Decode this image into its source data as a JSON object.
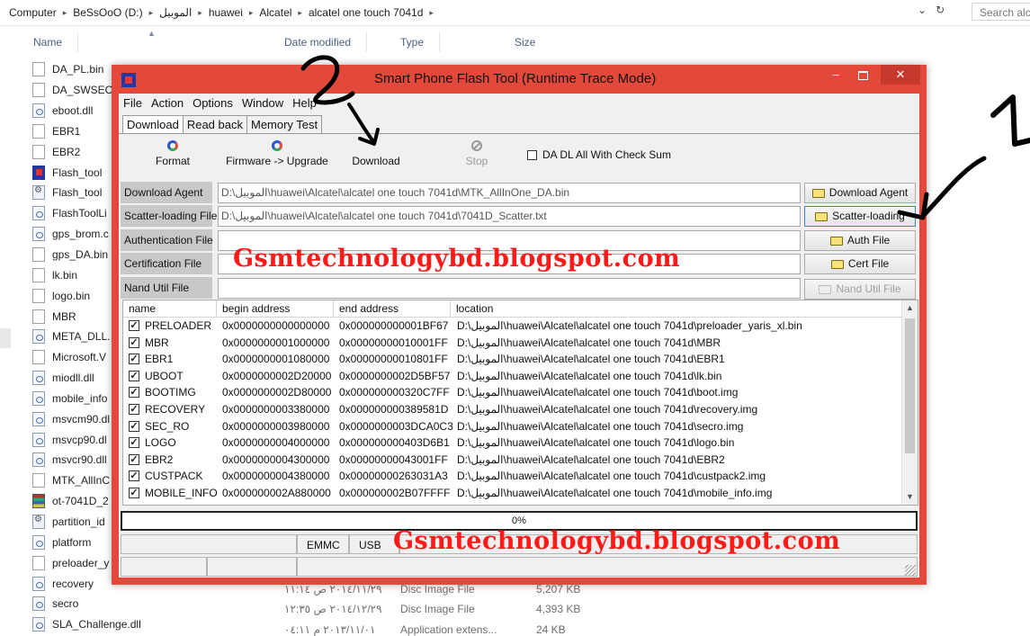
{
  "explorer": {
    "breadcrumbs": [
      "Computer",
      "BeSsOoO (D:)",
      "الموبيل",
      "huawei",
      "Alcatel",
      "alcatel one touch  7041d"
    ],
    "search_placeholder": "Search alc",
    "columns": {
      "name": "Name",
      "date": "Date modified",
      "type": "Type",
      "size": "Size"
    },
    "files": [
      {
        "name": "DA_PL.bin",
        "icon": "file-icon"
      },
      {
        "name": "DA_SWSEC.",
        "icon": "file-icon"
      },
      {
        "name": "eboot.dll",
        "icon": "dll-icon"
      },
      {
        "name": "EBR1",
        "icon": "file-icon"
      },
      {
        "name": "EBR2",
        "icon": "file-icon"
      },
      {
        "name": "Flash_tool",
        "icon": "exe-icon"
      },
      {
        "name": "Flash_tool",
        "icon": "config-icon"
      },
      {
        "name": "FlashToolLi",
        "icon": "dll-icon"
      },
      {
        "name": "gps_brom.c",
        "icon": "dll-icon"
      },
      {
        "name": "gps_DA.bin",
        "icon": "file-icon"
      },
      {
        "name": "lk.bin",
        "icon": "file-icon"
      },
      {
        "name": "logo.bin",
        "icon": "file-icon"
      },
      {
        "name": "MBR",
        "icon": "file-icon"
      },
      {
        "name": "META_DLL.",
        "icon": "dll-icon"
      },
      {
        "name": "Microsoft.V",
        "icon": "file-icon"
      },
      {
        "name": "miodll.dll",
        "icon": "dll-icon"
      },
      {
        "name": "mobile_info",
        "icon": "dll-icon"
      },
      {
        "name": "msvcm90.dl",
        "icon": "dll-icon"
      },
      {
        "name": "msvcp90.dl",
        "icon": "dll-icon"
      },
      {
        "name": "msvcr90.dll",
        "icon": "dll-icon"
      },
      {
        "name": "MTK_AllInC",
        "icon": "file-icon"
      },
      {
        "name": "ot-7041D_2",
        "icon": "rar-icon"
      },
      {
        "name": "partition_id",
        "icon": "config-icon"
      },
      {
        "name": "platform",
        "icon": "dll-icon"
      },
      {
        "name": "preloader_y",
        "icon": "file-icon"
      },
      {
        "name": "recovery",
        "icon": "dll-icon"
      },
      {
        "name": "secro",
        "icon": "dll-icon"
      },
      {
        "name": "SLA_Challenge.dll",
        "icon": "dll-icon"
      }
    ],
    "bottom_rows": [
      {
        "date": "٢٠١٤/١١/٢٩ ص ١١:١٤",
        "type": "Disc Image File",
        "size": "5,207 KB"
      },
      {
        "date": "٢٠١٤/١٢/٢٩ ص ١٢:٣٥",
        "type": "Disc Image File",
        "size": "4,393 KB"
      },
      {
        "date": "٢٠١٣/١١/٠١ م ٠٤:١١",
        "type": "Application extens...",
        "size": "24 KB"
      }
    ]
  },
  "flashtool": {
    "title": "Smart Phone Flash Tool (Runtime Trace Mode)",
    "menu": [
      "File",
      "Action",
      "Options",
      "Window",
      "Help"
    ],
    "tabs": [
      "Download",
      "Read back",
      "Memory Test"
    ],
    "toolbar": {
      "format": "Format",
      "firmware": "Firmware -> Upgrade",
      "download": "Download",
      "stop": "Stop"
    },
    "da_checksum_label": "DA DL All With Check Sum",
    "fields": [
      {
        "label": "Download Agent",
        "value": "D:\\الموبيل\\huawei\\Alcatel\\alcatel one touch  7041d\\MTK_AllInOne_DA.bin",
        "button": "Download Agent"
      },
      {
        "label": "Scatter-loading File",
        "value": "D:\\الموبيل\\huawei\\Alcatel\\alcatel one touch  7041d\\7041D_Scatter.txt",
        "button": "Scatter-loading"
      },
      {
        "label": "Authentication File",
        "value": "",
        "button": "Auth File"
      },
      {
        "label": "Certification File",
        "value": "",
        "button": "Cert File"
      },
      {
        "label": "Nand Util File",
        "value": "",
        "button": "Nand Util File"
      }
    ],
    "table": {
      "headers": [
        "name",
        "begin address",
        "end address",
        "location"
      ],
      "rows": [
        {
          "name": "PRELOADER",
          "begin": "0x0000000000000000",
          "end": "0x000000000001BF67",
          "location": "D:\\الموبيل\\huawei\\Alcatel\\alcatel one touch  7041d\\preloader_yaris_xl.bin"
        },
        {
          "name": "MBR",
          "begin": "0x0000000001000000",
          "end": "0x00000000010001FF",
          "location": "D:\\الموبيل\\huawei\\Alcatel\\alcatel one touch  7041d\\MBR"
        },
        {
          "name": "EBR1",
          "begin": "0x0000000001080000",
          "end": "0x00000000010801FF",
          "location": "D:\\الموبيل\\huawei\\Alcatel\\alcatel one touch  7041d\\EBR1"
        },
        {
          "name": "UBOOT",
          "begin": "0x0000000002D20000",
          "end": "0x0000000002D5BF57",
          "location": "D:\\الموبيل\\huawei\\Alcatel\\alcatel one touch  7041d\\lk.bin"
        },
        {
          "name": "BOOTIMG",
          "begin": "0x0000000002D80000",
          "end": "0x000000000320C7FF",
          "location": "D:\\الموبيل\\huawei\\Alcatel\\alcatel one touch  7041d\\boot.img"
        },
        {
          "name": "RECOVERY",
          "begin": "0x0000000003380000",
          "end": "0x000000000389581D",
          "location": "D:\\الموبيل\\huawei\\Alcatel\\alcatel one touch  7041d\\recovery.img"
        },
        {
          "name": "SEC_RO",
          "begin": "0x0000000003980000",
          "end": "0x0000000003DCA0C3",
          "location": "D:\\الموبيل\\huawei\\Alcatel\\alcatel one touch  7041d\\secro.img"
        },
        {
          "name": "LOGO",
          "begin": "0x0000000004000000",
          "end": "0x000000000403D6B1",
          "location": "D:\\الموبيل\\huawei\\Alcatel\\alcatel one touch  7041d\\logo.bin"
        },
        {
          "name": "EBR2",
          "begin": "0x0000000004300000",
          "end": "0x00000000043001FF",
          "location": "D:\\الموبيل\\huawei\\Alcatel\\alcatel one touch  7041d\\EBR2"
        },
        {
          "name": "CUSTPACK",
          "begin": "0x0000000004380000",
          "end": "0x00000000263031A3",
          "location": "D:\\الموبيل\\huawei\\Alcatel\\alcatel one touch  7041d\\custpack2.img"
        },
        {
          "name": "MOBILE_INFO",
          "begin": "0x000000002A880000",
          "end": "0x000000002B07FFFF",
          "location": "D:\\الموبيل\\huawei\\Alcatel\\alcatel one touch  7041d\\mobile_info.img"
        }
      ]
    },
    "progress_text": "0%",
    "progress_value": 0,
    "status": {
      "emmc": "EMMC",
      "usb": "USB"
    }
  },
  "overlay": {
    "watermark": "Gsmtechnologybd.blogspot.com",
    "annotation_1": "1",
    "annotation_2": "2",
    "annotation_color": "#000000"
  },
  "colors": {
    "titlebar": "#e3493b",
    "close_button": "#c8392d",
    "watermark": "#ff1a1a"
  }
}
